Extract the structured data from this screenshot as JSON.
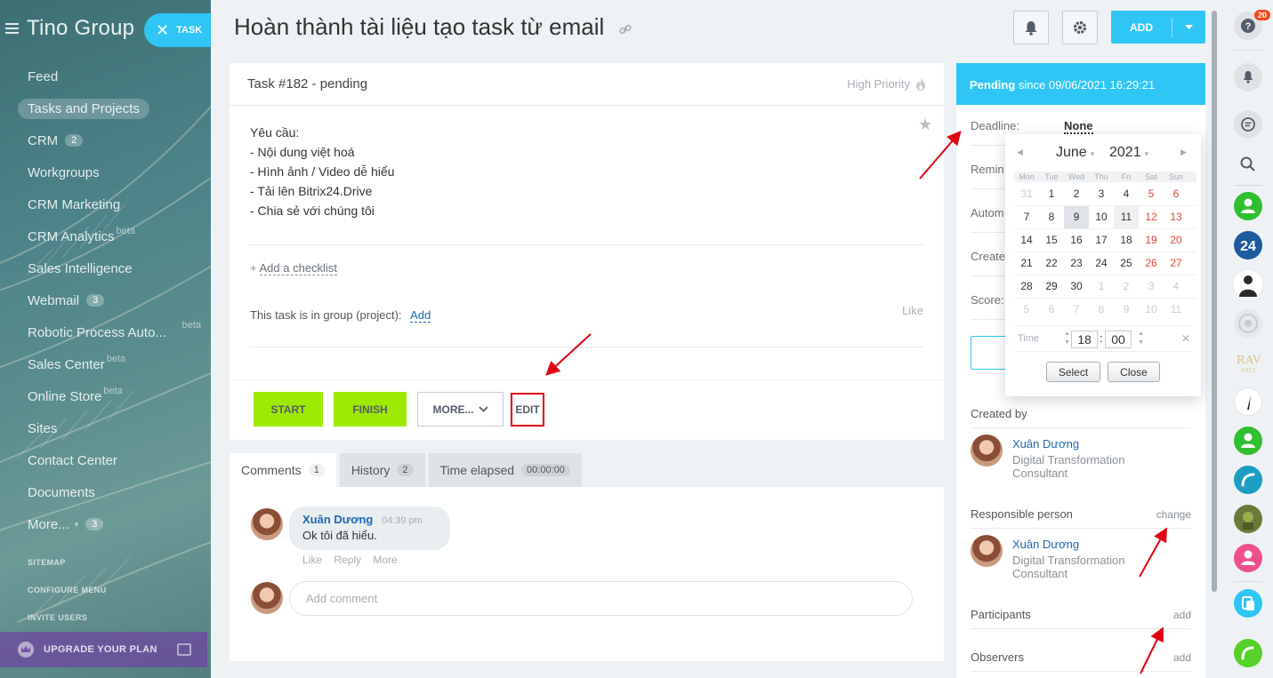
{
  "sidebar": {
    "logo": "Tino Group",
    "task_pill": "TASK",
    "items": [
      {
        "label": "Feed"
      },
      {
        "label": "Tasks and Projects"
      },
      {
        "label": "CRM",
        "count": "2"
      },
      {
        "label": "Workgroups"
      },
      {
        "label": "CRM Marketing"
      },
      {
        "label": "CRM Analytics",
        "beta": "beta"
      },
      {
        "label": "Sales Intelligence"
      },
      {
        "label": "Webmail",
        "count": "3"
      },
      {
        "label": "Robotic Process Auto...",
        "beta": "beta"
      },
      {
        "label": "Sales Center",
        "beta": "beta"
      },
      {
        "label": "Online Store",
        "beta": "beta"
      },
      {
        "label": "Sites"
      },
      {
        "label": "Contact Center"
      },
      {
        "label": "Documents"
      },
      {
        "label": "More...",
        "count": "3"
      }
    ],
    "links": [
      "SITEMAP",
      "CONFIGURE MENU",
      "INVITE USERS"
    ],
    "upgrade": "UPGRADE YOUR PLAN"
  },
  "header": {
    "title": "Hoàn thành tài liệu tạo task từ email",
    "add_label": "ADD"
  },
  "task": {
    "title": "Task #182 - pending",
    "priority": "High Priority",
    "description": [
      "Yêu cầu:",
      "- Nội dung việt hoá",
      "- Hình ảnh / Video dễ hiểu",
      "- Tải lên Bitrix24.Drive",
      "- Chia sẻ với chúng tôi"
    ],
    "checklist_prefix": "+",
    "checklist_label": "Add a checklist",
    "group_label": "This task is in group (project):",
    "group_add": "Add",
    "like": "Like",
    "buttons": {
      "start": "START",
      "finish": "FINISH",
      "more": "MORE...",
      "edit": "EDIT"
    }
  },
  "tabs": [
    {
      "label": "Comments",
      "count": "1"
    },
    {
      "label": "History",
      "count": "2"
    },
    {
      "label": "Time elapsed",
      "count": "00:00:00"
    }
  ],
  "comment": {
    "author": "Xuân Dương",
    "time": "04:39 pm",
    "text": "Ok tôi đã hiểu.",
    "actions": [
      "Like",
      "Reply",
      "More"
    ],
    "placeholder": "Add comment"
  },
  "panel": {
    "status_bold": "Pending",
    "status_rest": "since 09/06/2021 16:29:21",
    "deadline_label": "Deadline:",
    "deadline_value": "None",
    "remind_label": "Remin",
    "automation_label": "Autom",
    "created_label": "Create",
    "score_label": "Score:",
    "created_by": "Created by",
    "responsible": "Responsible person",
    "change": "change",
    "participants": "Participants",
    "observers": "Observers",
    "add": "add",
    "person_name": "Xuân Dương",
    "person_pos_1": "Digital Transformation",
    "person_pos_2": "Consultant"
  },
  "calendar": {
    "month": "June",
    "year": "2021",
    "dow": [
      "Mon",
      "Tue",
      "Wed",
      "Thu",
      "Fri",
      "Sat",
      "Sun"
    ],
    "weeks": [
      [
        "31",
        "1",
        "2",
        "3",
        "4",
        "5",
        "6"
      ],
      [
        "7",
        "8",
        "9",
        "10",
        "11",
        "12",
        "13"
      ],
      [
        "14",
        "15",
        "16",
        "17",
        "18",
        "19",
        "20"
      ],
      [
        "21",
        "22",
        "23",
        "24",
        "25",
        "26",
        "27"
      ],
      [
        "28",
        "29",
        "30",
        "1",
        "2",
        "3",
        "4"
      ],
      [
        "5",
        "6",
        "7",
        "8",
        "9",
        "10",
        "11"
      ]
    ],
    "time_label": "Time",
    "hour": "18",
    "minute": "00",
    "select": "Select",
    "close": "Close"
  },
  "rail": {
    "badge": "20"
  },
  "colors": {
    "accent": "#2fc6f6",
    "green_button": "#9dea03",
    "link": "#2067b0",
    "weekend": "#e0453e",
    "highlight": "#e00010"
  }
}
